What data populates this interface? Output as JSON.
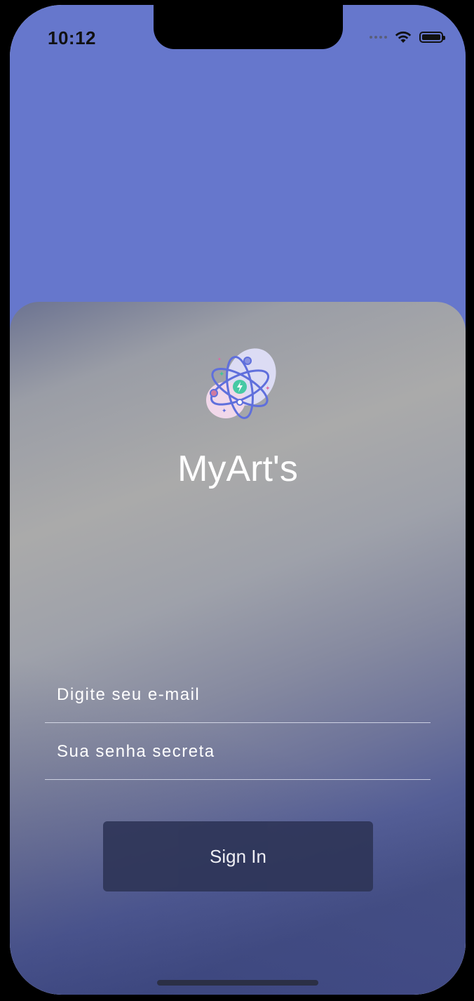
{
  "status_bar": {
    "time": "10:12"
  },
  "app": {
    "title": "MyArt's"
  },
  "form": {
    "email_placeholder": "Digite seu e-mail",
    "password_placeholder": "Sua senha secreta",
    "signin_label": "Sign In"
  },
  "colors": {
    "background_accent": "#6677cc",
    "button": "#2d3457",
    "text": "#ffffff"
  },
  "icons": [
    "wifi-icon",
    "battery-icon",
    "atom-logo-icon"
  ]
}
